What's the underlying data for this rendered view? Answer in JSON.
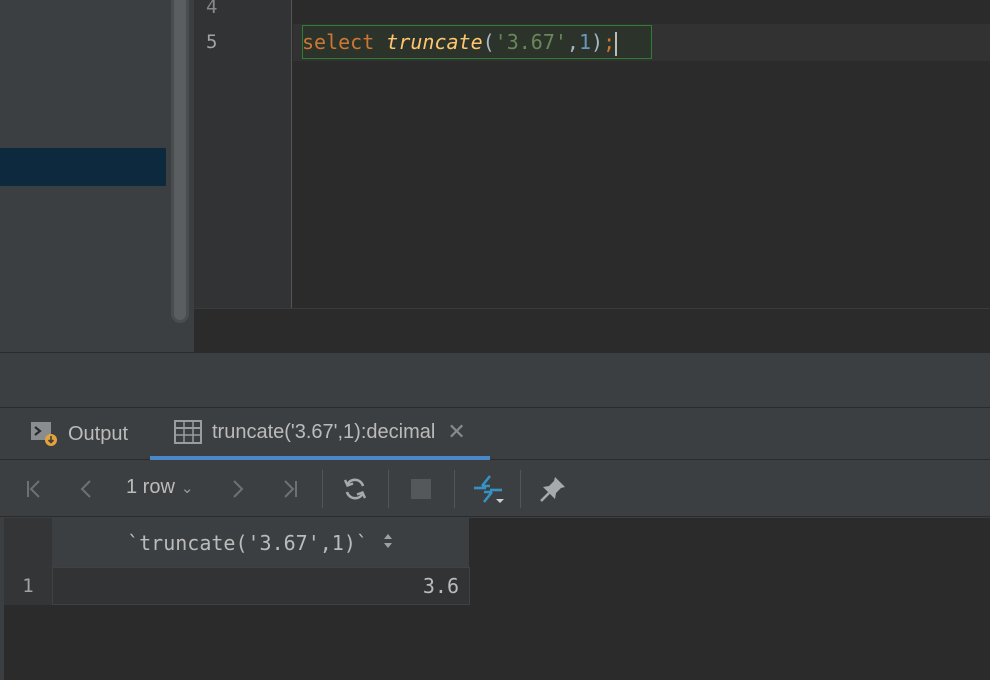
{
  "editor": {
    "line_numbers": [
      "4",
      "5"
    ],
    "code": {
      "keyword": "select",
      "function": "truncate",
      "open_paren": "(",
      "string_arg": "'3.67'",
      "comma": ",",
      "number_arg": "1",
      "close_paren": ")",
      "semicolon": ";"
    }
  },
  "tool_window": {
    "tabs": [
      {
        "label": "Output",
        "icon": "console-icon"
      },
      {
        "label": "truncate('3.67',1):decimal",
        "icon": "table-icon",
        "close": "✕"
      }
    ],
    "toolbar": {
      "row_count": "1 row",
      "buttons": [
        "first-page-icon",
        "previous-page-icon",
        "next-page-icon",
        "last-page-icon",
        "refresh-icon",
        "stop-icon",
        "compare-icon",
        "pin-icon"
      ]
    },
    "grid": {
      "columns": [
        "`truncate('3.67',1)`"
      ],
      "rows": [
        {
          "row_number": "1",
          "values": [
            "3.6"
          ]
        }
      ]
    }
  },
  "colors": {
    "accent": "#4a88c7",
    "keyword": "#cc7832",
    "function": "#ffc66d",
    "string": "#6a8759",
    "number": "#6897bb",
    "statement_border": "#2e7d32"
  }
}
